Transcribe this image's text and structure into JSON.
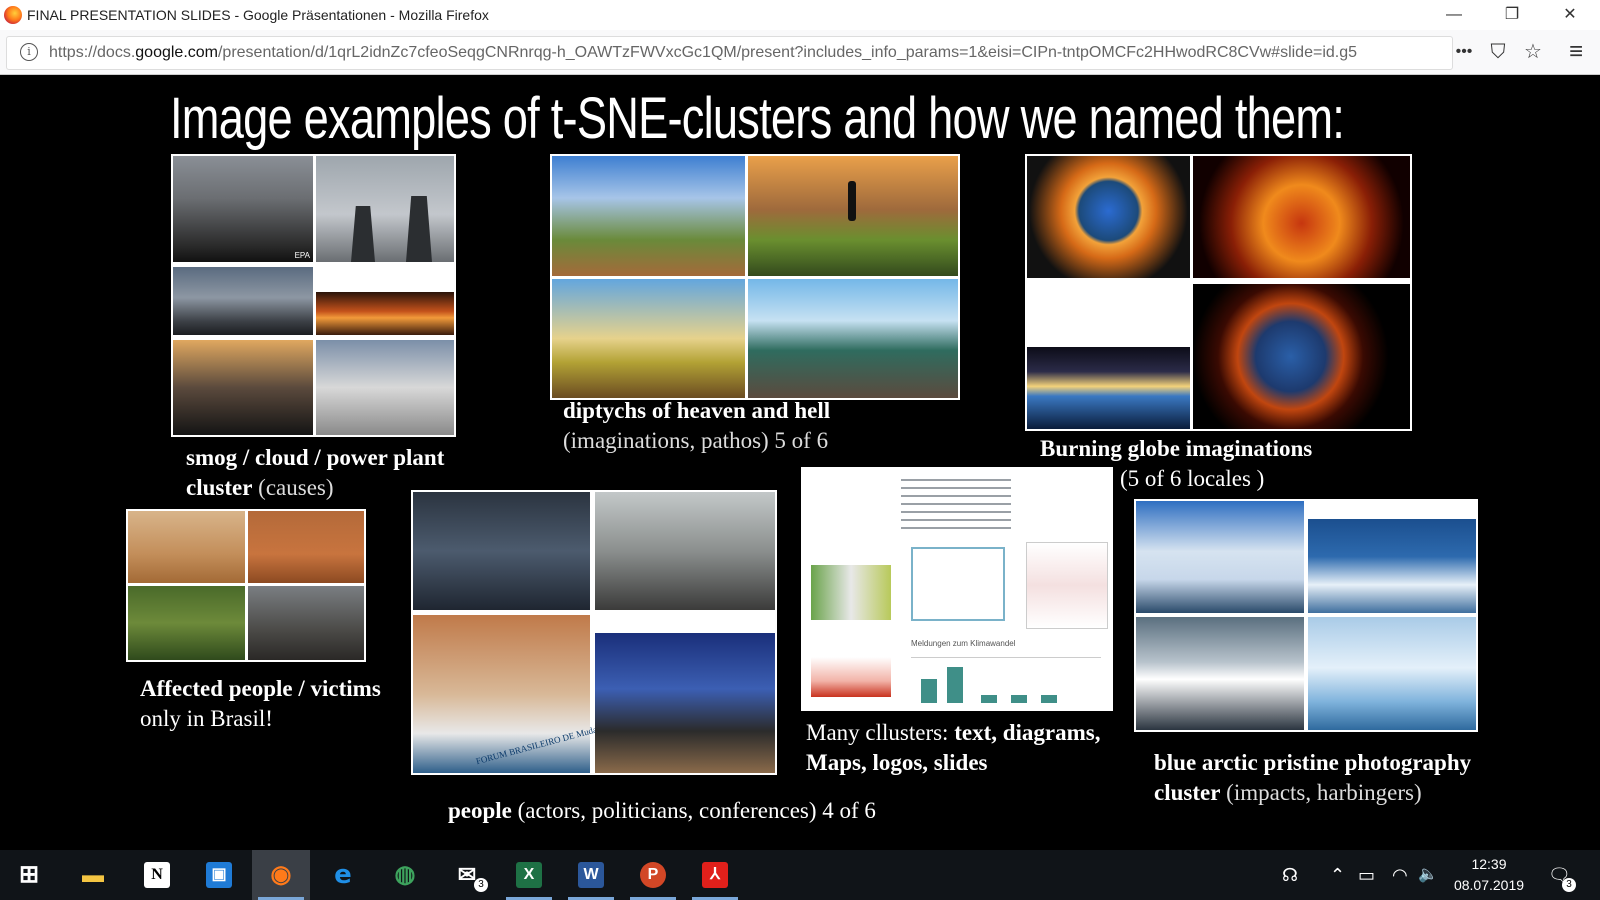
{
  "window": {
    "title": "FINAL PRESENTATION SLIDES - Google Präsentationen - Mozilla Firefox",
    "minimize_glyph": "—",
    "maximize_glyph": "❐",
    "close_glyph": "✕"
  },
  "browser": {
    "url_prefix": "https://docs.",
    "url_domain": "google.com",
    "url_rest": "/presentation/d/1qrL2idnZc7cfeoSeqgCNRnrqg-h_OAWTzFWVxcGc1QM/present?includes_info_params=1&eisi=CIPn-tntpOMCFc2HHwodRC8CVw#slide=id.g5",
    "info_glyph": "i",
    "more_glyph": "•••",
    "pocket_glyph": "⛉",
    "star_glyph": "☆",
    "menu_glyph": "≡"
  },
  "slide": {
    "title": "Image examples of t-SNE-clusters and how we named them:",
    "captions": {
      "smog": {
        "bold": "smog / cloud / power plant",
        "bold2": "cluster",
        "rest": " (causes)"
      },
      "diptychs": {
        "bold": "diptychs of heaven and hell",
        "rest": "(imaginations, pathos) 5 of 6"
      },
      "globe": {
        "bold": "Burning globe imaginations",
        "rest": "(5 of 6 locales )"
      },
      "victims": {
        "bold": "Affected people / victims",
        "rest": "only in Brasil!"
      },
      "people": {
        "bold": "people",
        "rest": " (actors, politicians, conferences) 4 of 6"
      },
      "many": {
        "pre": "Many cllusters: ",
        "bold": "text, diagrams,",
        "bold2": "Maps, logos, slides"
      },
      "arctic": {
        "bold": "blue arctic pristine photography",
        "bold2": "cluster",
        "rest": " (impacts, harbingers)"
      }
    },
    "photo_labels": {
      "epa": "EPA",
      "forum_banner": "FORUM BRASILEIRO DE Mudanças Climáticas",
      "doc_heading": "Meldungen zum Klimawandel"
    }
  },
  "taskbar": {
    "items": [
      {
        "name": "start",
        "glyph": "⊞",
        "color": "#ffffff"
      },
      {
        "name": "file-explorer",
        "glyph": "▬",
        "color": "#f4c542"
      },
      {
        "name": "notion",
        "glyph": "N",
        "color": "#ffffff"
      },
      {
        "name": "trello",
        "glyph": "▣",
        "color": "#1f7bd6"
      },
      {
        "name": "firefox",
        "glyph": "◉",
        "color": "#ff7a1a"
      },
      {
        "name": "edge",
        "glyph": "e",
        "color": "#1f8fe6"
      },
      {
        "name": "chrome-like",
        "glyph": "◍",
        "color": "#3da35d"
      },
      {
        "name": "mail",
        "glyph": "✉",
        "color": "#ffffff",
        "badge": "3"
      },
      {
        "name": "excel",
        "glyph": "X",
        "color": "#1e7145"
      },
      {
        "name": "word",
        "glyph": "W",
        "color": "#2b579a"
      },
      {
        "name": "powerpoint",
        "glyph": "P",
        "color": "#d24726"
      },
      {
        "name": "acrobat",
        "glyph": "⅄",
        "color": "#e0201b"
      }
    ],
    "tray": {
      "people_glyph": "☊",
      "chevron_glyph": "⌃",
      "battery_glyph": "▭",
      "wifi_glyph": "◠",
      "volume_glyph": "🔈",
      "time": "12:39",
      "date": "08.07.2019",
      "notifications_glyph": "🗨",
      "notifications_count": "3"
    }
  }
}
